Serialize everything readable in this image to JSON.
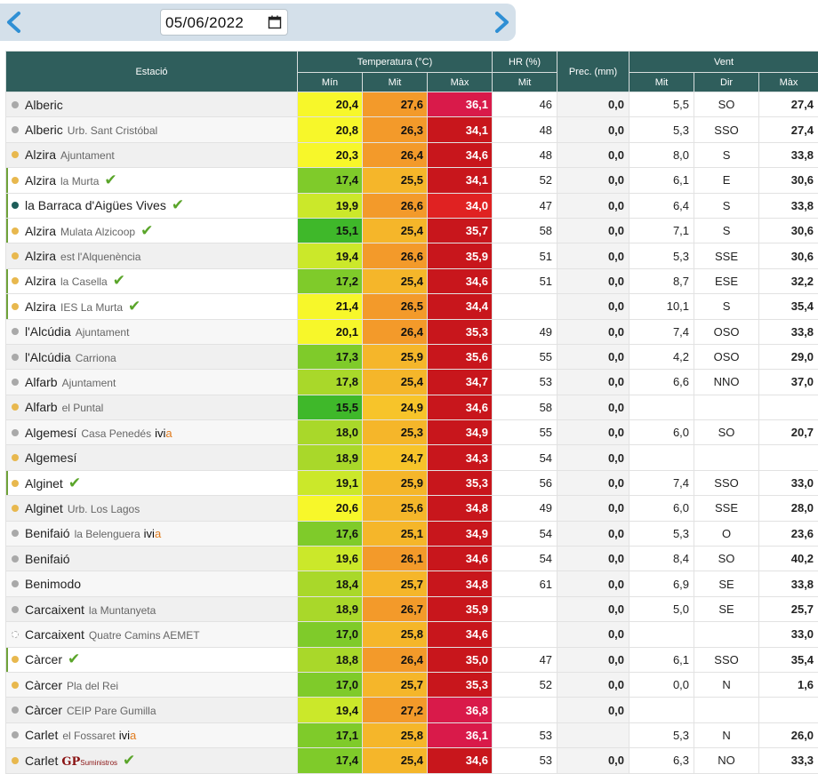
{
  "nav": {
    "date_value": "05/06/2022",
    "prev_icon": "chevron-left-icon",
    "next_icon": "chevron-right-icon",
    "calendar_icon": "calendar-icon",
    "accent": "#2f8fd4"
  },
  "header": {
    "station": "Estació",
    "temperature": "Temperatura (°C)",
    "hr": "HR (%)",
    "prec": "Prec. (mm)",
    "wind": "Vent",
    "min": "Mín",
    "mit": "Mit",
    "max": "Màx",
    "hr_mit": "Mit",
    "wind_mit": "Mit",
    "wind_dir": "Dir",
    "wind_max": "Màx"
  },
  "colors": {
    "header_bg": "#2f5e5c",
    "dot_yellow": "#e8b84e",
    "dot_grey": "#a9a9a9",
    "dot_teal": "#1e5e5a",
    "check": "#5aa52a"
  },
  "rows": [
    {
      "name": "Alberic",
      "sub": "",
      "dot": "grey",
      "check": false,
      "min": "20,4",
      "mit": "27,6",
      "max": "36,1",
      "hr": "46",
      "prec": "0,0",
      "vmit": "5,5",
      "dir": "SO",
      "vmax": "27,4",
      "cmin": "#f7f72a",
      "cmit": "#f39a2a",
      "cmax": "#d91a4a"
    },
    {
      "name": "Alberic",
      "sub": "Urb. Sant Cristóbal",
      "dot": "grey",
      "check": false,
      "min": "20,8",
      "mit": "26,3",
      "max": "34,1",
      "hr": "48",
      "prec": "0,0",
      "vmit": "5,3",
      "dir": "SSO",
      "vmax": "27,4",
      "cmin": "#f7f72a",
      "cmit": "#f39a2a",
      "cmax": "#c8161c"
    },
    {
      "name": "Alzira",
      "sub": "Ajuntament",
      "dot": "yellow",
      "check": false,
      "min": "20,3",
      "mit": "26,4",
      "max": "34,6",
      "hr": "48",
      "prec": "0,0",
      "vmit": "8,0",
      "dir": "S",
      "vmax": "33,8",
      "cmin": "#f7f72a",
      "cmit": "#f39a2a",
      "cmax": "#c8161c"
    },
    {
      "name": "Alzira",
      "sub": "la Murta",
      "dot": "yellow",
      "check": true,
      "hl": true,
      "min": "17,4",
      "mit": "25,5",
      "max": "34,1",
      "hr": "52",
      "prec": "0,0",
      "vmit": "6,1",
      "dir": "E",
      "vmax": "30,6",
      "cmin": "#7fcb2a",
      "cmit": "#f5b62a",
      "cmax": "#c8161c"
    },
    {
      "name": "la Barraca d'Aigües Vives",
      "sub": "",
      "dot": "teal",
      "check": true,
      "hl": true,
      "min": "19,9",
      "mit": "26,6",
      "max": "34,0",
      "hr": "47",
      "prec": "0,0",
      "vmit": "6,4",
      "dir": "S",
      "vmax": "33,8",
      "cmin": "#cbe82a",
      "cmit": "#f39a2a",
      "cmax": "#e02222"
    },
    {
      "name": "Alzira",
      "sub": "Mulata Alzicoop",
      "dot": "yellow",
      "check": true,
      "hl": true,
      "min": "15,1",
      "mit": "25,4",
      "max": "35,7",
      "hr": "58",
      "prec": "0,0",
      "vmit": "7,1",
      "dir": "S",
      "vmax": "30,6",
      "cmin": "#3fb82a",
      "cmit": "#f5b62a",
      "cmax": "#c8161c"
    },
    {
      "name": "Alzira",
      "sub": "est l'Alquenència",
      "dot": "yellow",
      "check": false,
      "min": "19,4",
      "mit": "26,6",
      "max": "35,9",
      "hr": "51",
      "prec": "0,0",
      "vmit": "5,3",
      "dir": "SSE",
      "vmax": "30,6",
      "cmin": "#cbe82a",
      "cmit": "#f39a2a",
      "cmax": "#c8161c"
    },
    {
      "name": "Alzira",
      "sub": "la Casella",
      "dot": "yellow",
      "check": true,
      "hl": true,
      "min": "17,2",
      "mit": "25,4",
      "max": "34,6",
      "hr": "51",
      "prec": "0,0",
      "vmit": "8,7",
      "dir": "ESE",
      "vmax": "32,2",
      "cmin": "#7fcb2a",
      "cmit": "#f5b62a",
      "cmax": "#c8161c"
    },
    {
      "name": "Alzira",
      "sub": "IES La Murta",
      "dot": "yellow",
      "check": true,
      "hl": true,
      "min": "21,4",
      "mit": "26,5",
      "max": "34,4",
      "hr": "",
      "prec": "0,0",
      "vmit": "10,1",
      "dir": "S",
      "vmax": "35,4",
      "cmin": "#f7f72a",
      "cmit": "#f39a2a",
      "cmax": "#c8161c"
    },
    {
      "name": "l'Alcúdia",
      "sub": "Ajuntament",
      "dot": "grey",
      "check": false,
      "min": "20,1",
      "mit": "26,4",
      "max": "35,3",
      "hr": "49",
      "prec": "0,0",
      "vmit": "7,4",
      "dir": "OSO",
      "vmax": "33,8",
      "cmin": "#f7f72a",
      "cmit": "#f39a2a",
      "cmax": "#c8161c"
    },
    {
      "name": "l'Alcúdia",
      "sub": "Carriona",
      "dot": "grey",
      "check": false,
      "min": "17,3",
      "mit": "25,9",
      "max": "35,6",
      "hr": "55",
      "prec": "0,0",
      "vmit": "4,2",
      "dir": "OSO",
      "vmax": "29,0",
      "cmin": "#7fcb2a",
      "cmit": "#f5b62a",
      "cmax": "#c8161c"
    },
    {
      "name": "Alfarb",
      "sub": "Ajuntament",
      "dot": "grey",
      "check": false,
      "min": "17,8",
      "mit": "25,4",
      "max": "34,7",
      "hr": "53",
      "prec": "0,0",
      "vmit": "6,6",
      "dir": "NNO",
      "vmax": "37,0",
      "cmin": "#a9d82a",
      "cmit": "#f5b62a",
      "cmax": "#c8161c"
    },
    {
      "name": "Alfarb",
      "sub": "el Puntal",
      "dot": "yellow",
      "check": false,
      "min": "15,5",
      "mit": "24,9",
      "max": "34,6",
      "hr": "58",
      "prec": "0,0",
      "vmit": "",
      "dir": "",
      "vmax": "",
      "cmin": "#3fb82a",
      "cmit": "#f7c42a",
      "cmax": "#c8161c"
    },
    {
      "name": "Algemesí",
      "sub": "Casa Penedés",
      "dot": "grey",
      "check": false,
      "brand": true,
      "min": "18,0",
      "mit": "25,3",
      "max": "34,9",
      "hr": "55",
      "prec": "0,0",
      "vmit": "6,0",
      "dir": "SO",
      "vmax": "20,7",
      "cmin": "#a9d82a",
      "cmit": "#f5b62a",
      "cmax": "#c8161c"
    },
    {
      "name": "Algemesí",
      "sub": "",
      "dot": "yellow",
      "check": false,
      "min": "18,9",
      "mit": "24,7",
      "max": "34,3",
      "hr": "54",
      "prec": "0,0",
      "vmit": "",
      "dir": "",
      "vmax": "",
      "cmin": "#a9d82a",
      "cmit": "#f7c42a",
      "cmax": "#c8161c"
    },
    {
      "name": "Alginet",
      "sub": "",
      "dot": "yellow",
      "check": true,
      "hl": true,
      "min": "19,1",
      "mit": "25,9",
      "max": "35,3",
      "hr": "56",
      "prec": "0,0",
      "vmit": "7,4",
      "dir": "SSO",
      "vmax": "33,0",
      "cmin": "#cbe82a",
      "cmit": "#f5b62a",
      "cmax": "#c8161c"
    },
    {
      "name": "Alginet",
      "sub": "Urb. Los Lagos",
      "dot": "yellow",
      "check": false,
      "min": "20,6",
      "mit": "25,6",
      "max": "34,8",
      "hr": "49",
      "prec": "0,0",
      "vmit": "6,0",
      "dir": "SSE",
      "vmax": "28,0",
      "cmin": "#f7f72a",
      "cmit": "#f5b62a",
      "cmax": "#c8161c"
    },
    {
      "name": "Benifaió",
      "sub": "la Belenguera",
      "dot": "grey",
      "check": false,
      "brand": true,
      "min": "17,6",
      "mit": "25,1",
      "max": "34,9",
      "hr": "54",
      "prec": "0,0",
      "vmit": "5,3",
      "dir": "O",
      "vmax": "23,6",
      "cmin": "#7fcb2a",
      "cmit": "#f5b62a",
      "cmax": "#c8161c"
    },
    {
      "name": "Benifaió",
      "sub": "",
      "dot": "grey",
      "check": false,
      "min": "19,6",
      "mit": "26,1",
      "max": "34,6",
      "hr": "54",
      "prec": "0,0",
      "vmit": "8,4",
      "dir": "SO",
      "vmax": "40,2",
      "cmin": "#cbe82a",
      "cmit": "#f39a2a",
      "cmax": "#c8161c"
    },
    {
      "name": "Benimodo",
      "sub": "",
      "dot": "grey",
      "check": false,
      "min": "18,4",
      "mit": "25,7",
      "max": "34,8",
      "hr": "61",
      "prec": "0,0",
      "vmit": "6,9",
      "dir": "SE",
      "vmax": "33,8",
      "cmin": "#a9d82a",
      "cmit": "#f5b62a",
      "cmax": "#c8161c"
    },
    {
      "name": "Carcaixent",
      "sub": "la Muntanyeta",
      "dot": "grey",
      "check": false,
      "min": "18,9",
      "mit": "26,7",
      "max": "35,9",
      "hr": "",
      "prec": "0,0",
      "vmit": "5,0",
      "dir": "SE",
      "vmax": "25,7",
      "cmin": "#a9d82a",
      "cmit": "#f39a2a",
      "cmax": "#c8161c"
    },
    {
      "name": "Carcaixent",
      "sub": "Quatre Camins AEMET",
      "dot": "empty",
      "check": false,
      "min": "17,0",
      "mit": "25,8",
      "max": "34,6",
      "hr": "",
      "prec": "0,0",
      "vmit": "",
      "dir": "",
      "vmax": "33,0",
      "cmin": "#7fcb2a",
      "cmit": "#f5b62a",
      "cmax": "#c8161c"
    },
    {
      "name": "Càrcer",
      "sub": "",
      "dot": "yellow",
      "check": true,
      "hl": true,
      "min": "18,8",
      "mit": "26,4",
      "max": "35,0",
      "hr": "47",
      "prec": "0,0",
      "vmit": "6,1",
      "dir": "SSO",
      "vmax": "35,4",
      "cmin": "#a9d82a",
      "cmit": "#f39a2a",
      "cmax": "#c8161c"
    },
    {
      "name": "Càrcer",
      "sub": "Pla del Rei",
      "dot": "yellow",
      "check": false,
      "min": "17,0",
      "mit": "25,7",
      "max": "35,3",
      "hr": "52",
      "prec": "0,0",
      "vmit": "0,0",
      "dir": "N",
      "vmax": "1,6",
      "cmin": "#7fcb2a",
      "cmit": "#f5b62a",
      "cmax": "#c8161c"
    },
    {
      "name": "Càrcer",
      "sub": "CEIP Pare Gumilla",
      "dot": "grey",
      "check": false,
      "min": "19,4",
      "mit": "27,2",
      "max": "36,8",
      "hr": "",
      "prec": "0,0",
      "vmit": "",
      "dir": "",
      "vmax": "",
      "cmin": "#cbe82a",
      "cmit": "#f39a2a",
      "cmax": "#d91a4a"
    },
    {
      "name": "Carlet",
      "sub": "el Fossaret",
      "dot": "grey",
      "check": false,
      "brand": true,
      "min": "17,1",
      "mit": "25,8",
      "max": "36,1",
      "hr": "53",
      "prec": "",
      "vmit": "5,3",
      "dir": "N",
      "vmax": "26,0",
      "cmin": "#7fcb2a",
      "cmit": "#f5b62a",
      "cmax": "#d91a4a"
    },
    {
      "name": "Carlet",
      "sub": "",
      "dot": "yellow",
      "check": true,
      "gp": true,
      "min": "17,4",
      "mit": "25,4",
      "max": "34,6",
      "hr": "53",
      "prec": "0,0",
      "vmit": "6,3",
      "dir": "NO",
      "vmax": "33,3",
      "cmin": "#7fcb2a",
      "cmit": "#f5b62a",
      "cmax": "#c8161c"
    }
  ],
  "brand_label": {
    "p1": "ivi",
    "p2": "a"
  },
  "gp_label": {
    "p1": "GP",
    "p2": "Suministros"
  }
}
